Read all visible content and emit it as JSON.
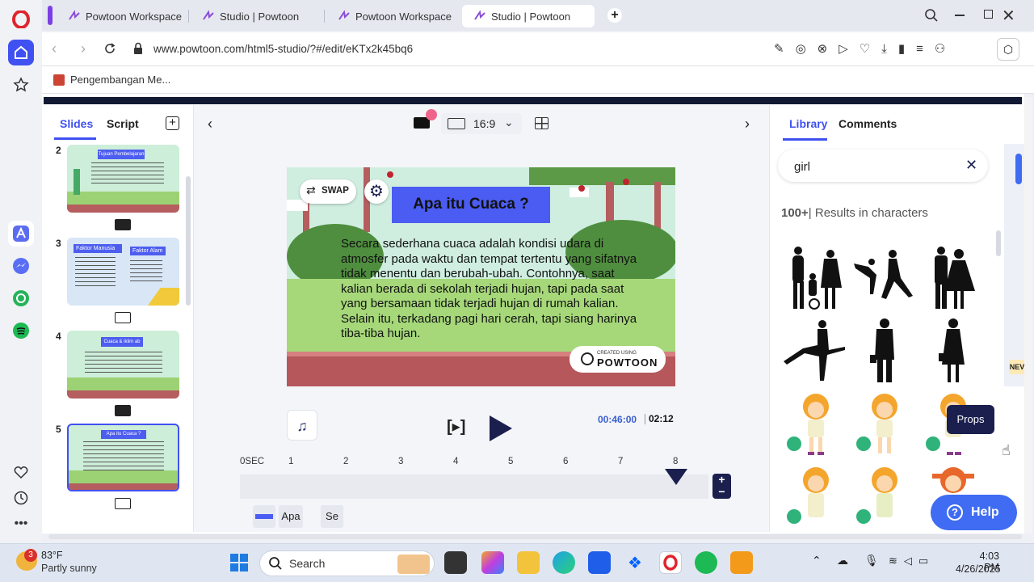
{
  "browser": {
    "tabs": [
      {
        "label": "Powtoon Workspace"
      },
      {
        "label": "Studio | Powtoon"
      },
      {
        "label": "Powtoon Workspace"
      },
      {
        "label": "Studio | Powtoon"
      }
    ],
    "url": "www.powtoon.com/html5-studio/?#/edit/eKTx2k45bq6",
    "bookmark": "Pengembangan Me..."
  },
  "studio": {
    "left_tabs": {
      "slides": "Slides",
      "script": "Script"
    },
    "aspect": "16:9",
    "slide_numbers": [
      "2",
      "3",
      "4",
      "5"
    ],
    "thumb3": {
      "left": "Faktor Manusia",
      "right": "Faktor Alam"
    },
    "thumb4": {
      "title": "Cuaca & iklim ab"
    },
    "thumb5": {
      "title": "Apa itu Cuaca ?"
    },
    "thumb2": {
      "title": "Tujuan Pembelajaran"
    },
    "slide": {
      "swap_label": "SWAP",
      "title": "Apa itu Cuaca ?",
      "body": "Secara sederhana cuaca adalah kondisi udara di atmosfer pada waktu dan tempat tertentu yang sifatnya tidak menentu dan berubah-ubah. Contohnya, saat kalian berada di sekolah terjadi hujan, tapi pada saat yang bersamaan tidak terjadi hujan di rumah kalian. Selain itu, terkadang pagi hari cerah, tapi siang harinya tiba-tiba hujan.",
      "badge_small": "CREATED USING",
      "badge_brand": "POWTOON"
    },
    "timer": {
      "current": "00:46:00",
      "total": "02:12"
    },
    "timeline": {
      "ticks": [
        "0SEC",
        "1",
        "2",
        "3",
        "4",
        "5",
        "6",
        "7",
        "8"
      ],
      "tracks": [
        "Apa",
        "Se"
      ]
    }
  },
  "library": {
    "tabs": {
      "library": "Library",
      "comments": "Comments"
    },
    "search_value": "girl",
    "results_count": "100+",
    "results_label": "| Results in characters",
    "tooltip": "Props",
    "side_badge": "NEV",
    "help": "Help"
  },
  "taskbar": {
    "weather_temp": "83°F",
    "weather_desc": "Partly sunny",
    "weather_badge": "3",
    "search_label": "Search",
    "time": "4:03 PM",
    "date": "4/26/2025"
  },
  "colors": {
    "accent": "#3f51f0",
    "opera_red": "#e0242b",
    "play_navy": "#1a1f4e",
    "help_blue": "#3f6cf3",
    "slide_grass": "#a6d87a",
    "slide_soil": "#b6575c"
  }
}
